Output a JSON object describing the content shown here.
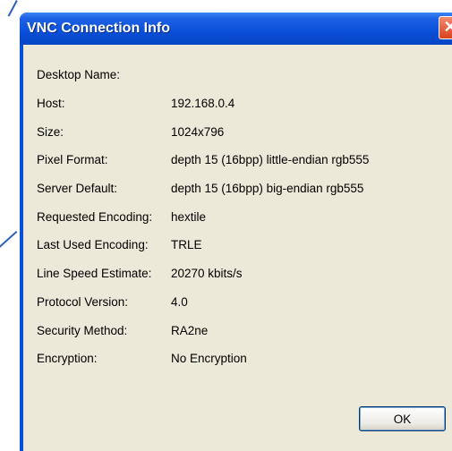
{
  "window": {
    "title": "VNC Connection Info",
    "close_glyph": "✕"
  },
  "info": [
    {
      "label": "Desktop Name:",
      "value": ""
    },
    {
      "label": "Host:",
      "value": "192.168.0.4"
    },
    {
      "label": "Size:",
      "value": "1024x796"
    },
    {
      "label": "Pixel Format:",
      "value": "depth 15 (16bpp) little-endian rgb555"
    },
    {
      "label": "Server Default:",
      "value": "depth 15 (16bpp) big-endian rgb555"
    },
    {
      "label": "Requested Encoding:",
      "value": "hextile"
    },
    {
      "label": "Last Used Encoding:",
      "value": "TRLE"
    },
    {
      "label": "Line Speed Estimate:",
      "value": "20270 kbits/s"
    },
    {
      "label": "Protocol Version:",
      "value": "4.0"
    },
    {
      "label": "Security Method:",
      "value": "RA2ne"
    },
    {
      "label": "Encryption:",
      "value": "No Encryption"
    }
  ],
  "buttons": {
    "ok_label": "OK"
  },
  "colors": {
    "titlebar": "#0a4fd8",
    "client": "#ece9d8",
    "close_button": "#d9431f"
  }
}
